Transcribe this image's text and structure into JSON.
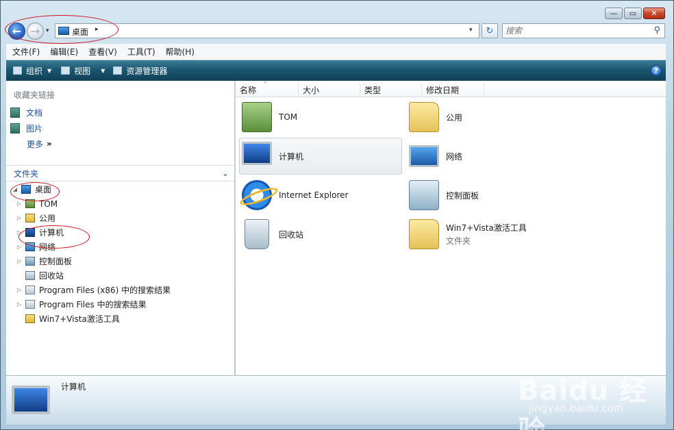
{
  "window": {
    "minimize": "—",
    "maximize": "▭",
    "close": "✕"
  },
  "nav": {
    "back": "←",
    "forward": "→",
    "history_dropdown": "▾"
  },
  "address": {
    "location": "桌面",
    "arrow": "▸",
    "dropdown": "▾",
    "refresh": "↻"
  },
  "search": {
    "placeholder": "搜索",
    "icon": "⚲"
  },
  "menu": [
    "文件(F)",
    "编辑(E)",
    "查看(V)",
    "工具(T)",
    "帮助(H)"
  ],
  "commands": {
    "organize": "组织",
    "views": "视图",
    "explorer": "资源管理器",
    "help": "?"
  },
  "favorites": {
    "title": "收藏夹链接",
    "items": [
      "文档",
      "图片"
    ],
    "more": "更多",
    "more_icon": "»"
  },
  "folders": {
    "title": "文件夹",
    "chevron": "⌄",
    "tree": [
      {
        "label": "桌面",
        "icon": "desktop",
        "expander": "◢"
      },
      {
        "label": "TOM",
        "icon": "user",
        "expander": "▷"
      },
      {
        "label": "公用",
        "icon": "folder",
        "expander": "▷"
      },
      {
        "label": "计算机",
        "icon": "computer",
        "expander": "▷"
      },
      {
        "label": "网络",
        "icon": "network",
        "expander": "▷"
      },
      {
        "label": "控制面板",
        "icon": "control-panel",
        "expander": "▷"
      },
      {
        "label": "回收站",
        "icon": "recycle-bin",
        "expander": ""
      },
      {
        "label": "Program Files (x86) 中的搜索结果",
        "icon": "search",
        "expander": "▷"
      },
      {
        "label": "Program Files 中的搜索结果",
        "icon": "search",
        "expander": "▷"
      },
      {
        "label": "Win7+Vista激活工具",
        "icon": "folder",
        "expander": ""
      }
    ]
  },
  "columns": [
    "名称",
    "大小",
    "类型",
    "修改日期"
  ],
  "sort_indicator": "^",
  "files": [
    {
      "name": "TOM",
      "icon": "user",
      "sub": ""
    },
    {
      "name": "公用",
      "icon": "folder",
      "sub": ""
    },
    {
      "name": "计算机",
      "icon": "computer",
      "sub": "",
      "selected": true
    },
    {
      "name": "网络",
      "icon": "network",
      "sub": ""
    },
    {
      "name": "Internet Explorer",
      "icon": "internet-explorer",
      "sub": ""
    },
    {
      "name": "控制面板",
      "icon": "control-panel",
      "sub": ""
    },
    {
      "name": "回收站",
      "icon": "recycle-bin",
      "sub": ""
    },
    {
      "name": "Win7+Vista激活工具",
      "icon": "folder",
      "sub": "文件夹"
    }
  ],
  "details": {
    "name": "计算机"
  },
  "watermark": {
    "logo": "Baidu 经验",
    "url": "jingyan.baidu.com"
  }
}
